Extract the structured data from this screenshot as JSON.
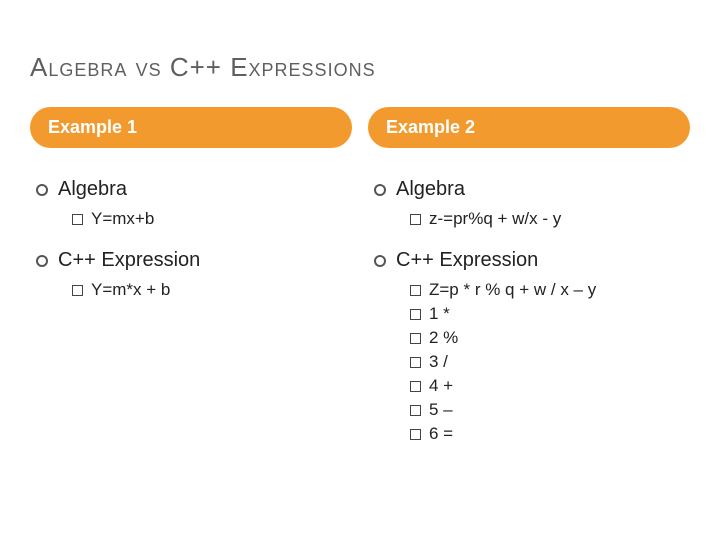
{
  "title": "Algebra vs C++ Expressions",
  "left": {
    "pill": "Example 1",
    "algebra": {
      "heading": "Algebra",
      "item": "Y=mx+b"
    },
    "cpp": {
      "heading": "C++ Expression",
      "item": "Y=m*x + b"
    }
  },
  "right": {
    "pill": "Example 2",
    "algebra": {
      "heading": "Algebra",
      "item": "z-=pr%q + w/x - y"
    },
    "cpp": {
      "heading": "C++ Expression",
      "items": [
        "Z=p * r % q + w / x – y",
        "1 *",
        "2 %",
        "3 /",
        "4 +",
        "5 –",
        "6 ="
      ]
    }
  }
}
